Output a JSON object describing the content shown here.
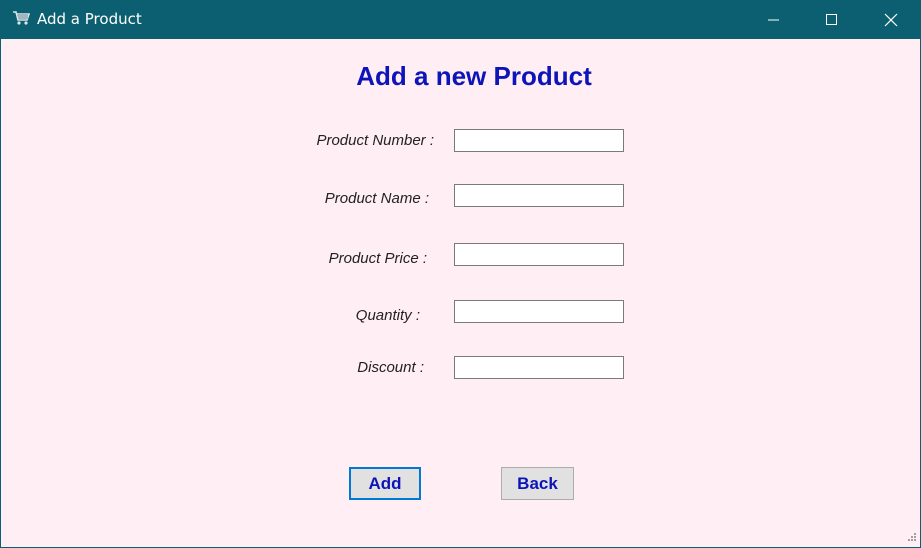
{
  "window": {
    "title": "Add a Product",
    "icon": "shopping-cart-icon",
    "controls": [
      "minimize-icon",
      "maximize-icon",
      "close-icon"
    ]
  },
  "form": {
    "heading": "Add a new Product",
    "fields": [
      {
        "label": "Product Number :",
        "value": ""
      },
      {
        "label": "Product Name :",
        "value": ""
      },
      {
        "label": "Product Price :",
        "value": ""
      },
      {
        "label": "Quantity :",
        "value": ""
      },
      {
        "label": "Discount :",
        "value": ""
      }
    ],
    "add_label": "Add",
    "back_label": "Back"
  },
  "colors": {
    "titlebar": "#0b5f70",
    "background": "#ffeef3",
    "accent_text": "#0d14b8",
    "focus_border": "#0078d7"
  }
}
